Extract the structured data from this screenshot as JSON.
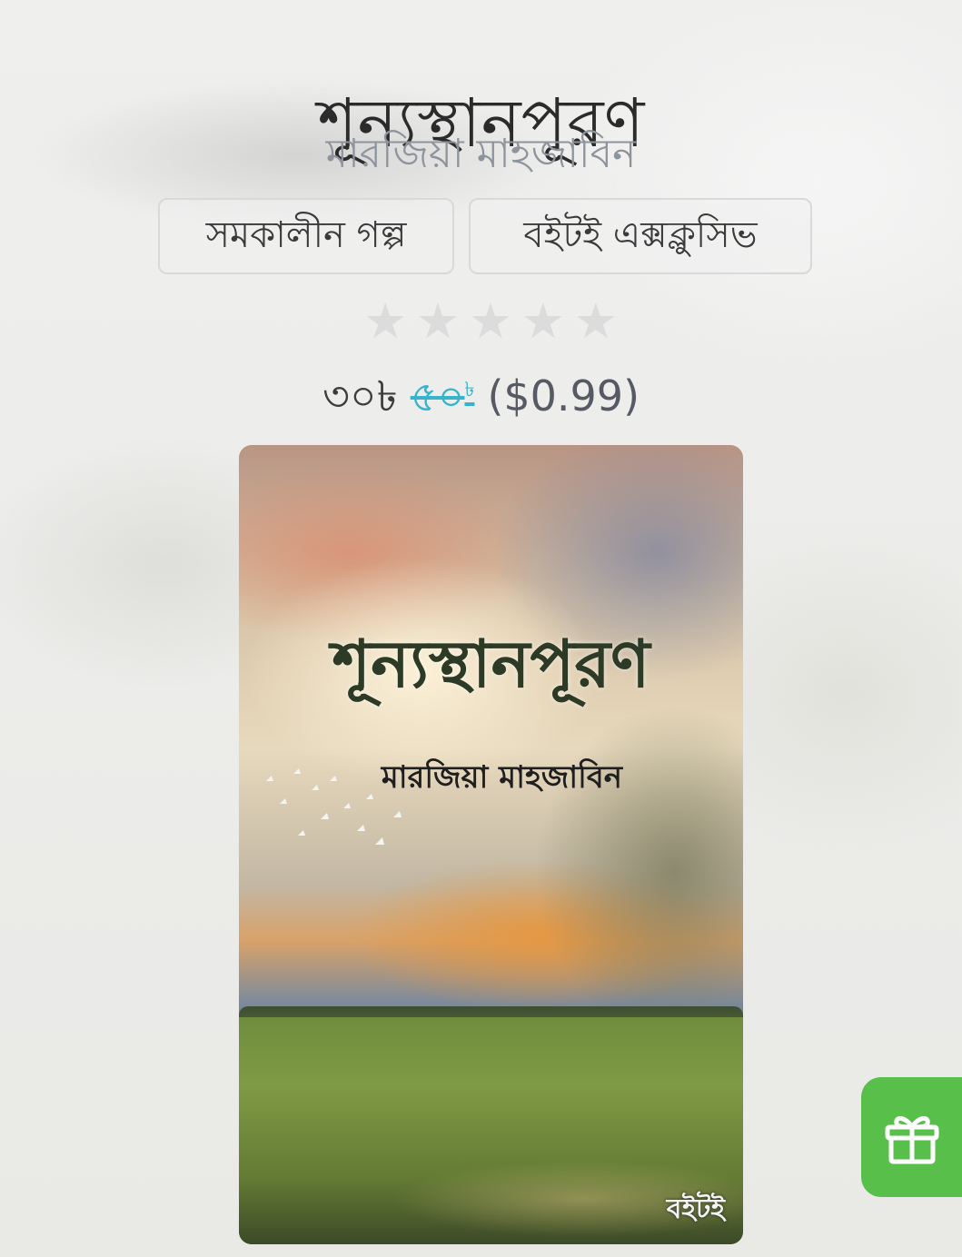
{
  "book": {
    "title": "শূন্যস্থানপূরণ",
    "author": "মারজিয়া মাহজাবিন"
  },
  "tags": [
    {
      "label": "সমকালীন গল্প"
    },
    {
      "label": "বইটই এক্সক্লুসিভ"
    }
  ],
  "rating": {
    "value": 0,
    "max": 5,
    "star_glyph": "★"
  },
  "price": {
    "current": "৩০৳",
    "original": "৫০",
    "original_currency": "৳",
    "usd": "($0.99)"
  },
  "cover": {
    "title": "শূন্যস্থানপূরণ",
    "author": "মারজিয়া মাহজাবিন",
    "publisher_logo": "বইটই"
  },
  "colors": {
    "accent_green": "#57bf4a",
    "strike_price": "#35b4cc",
    "author_gray": "#8d949c"
  },
  "icons": {
    "gift": "gift-icon",
    "star": "star-icon"
  }
}
